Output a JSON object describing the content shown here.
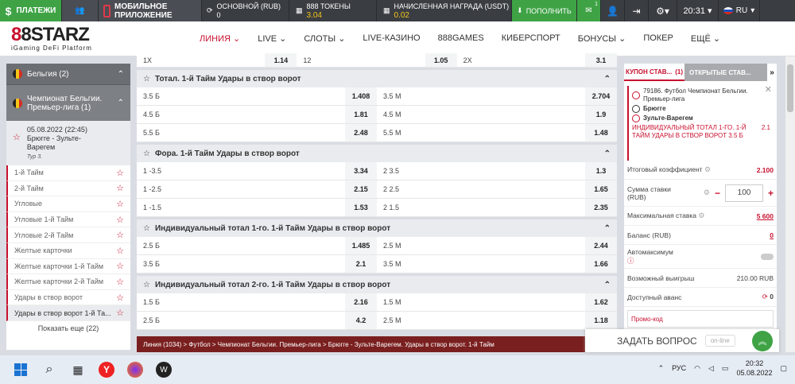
{
  "topbar": {
    "payments": "ПЛАТЕЖИ",
    "mobile": "МОБИЛЬНОЕ ПРИЛОЖЕНИЕ",
    "balance_label": "ОСНОВНОЙ (RUB)",
    "balance_value": "0",
    "tokens_label": "888 ТОКЕНЫ",
    "tokens_value": "3.04",
    "reward_label": "НАЧИСЛЕННАЯ НАГРАДА (USDT)",
    "reward_value": "0.02",
    "deposit": "ПОПОЛНИТЬ",
    "msg_count": "1",
    "time": "20:31",
    "lang": "RU"
  },
  "logo": {
    "brand_a": "8",
    "brand_b": "8STARZ",
    "sub": "iGaming DeFi Platform"
  },
  "nav": [
    "ЛИНИЯ",
    "LIVE",
    "СЛОТЫ",
    "LIVE-КАЗИНО",
    "888GAMES",
    "КИБЕРСПОРТ",
    "БОНУСЫ",
    "ПОКЕР",
    "ЕЩЁ"
  ],
  "left": {
    "country": "Бельгия (2)",
    "league": "Чемпионат Бельгии. Премьер-лига (1)",
    "match_date": "05.08.2022 (22:45)",
    "match_name": "Брюгге - Зульте-Варегем",
    "match_round": "Тур 3.",
    "items": [
      "1-й Тайм",
      "2-й Тайм",
      "Угловые",
      "Угловые 1-й Тайм",
      "Угловые 2-й Тайм",
      "Желтые карточки",
      "Желтые карточки 1-й Тайм",
      "Желтые карточки 2-й Тайм",
      "Удары в створ ворот",
      "Удары в створ ворот 1-й Та..."
    ],
    "more": "Показать еще (22)"
  },
  "top_row": [
    [
      "1X",
      "1.14"
    ],
    [
      "12",
      "1.05"
    ],
    [
      "2X",
      "3.1"
    ]
  ],
  "groups": [
    {
      "title": "Тотал. 1-й Тайм Удары в створ ворот",
      "rows": [
        [
          [
            "3.5 Б",
            "1.408"
          ],
          [
            "3.5 М",
            "2.704"
          ]
        ],
        [
          [
            "4.5 Б",
            "1.81"
          ],
          [
            "4.5 М",
            "1.9"
          ]
        ],
        [
          [
            "5.5 Б",
            "2.48"
          ],
          [
            "5.5 М",
            "1.48"
          ]
        ]
      ]
    },
    {
      "title": "Фора. 1-й Тайм Удары в створ ворот",
      "rows": [
        [
          [
            "1 -3.5",
            "3.34"
          ],
          [
            "2 3.5",
            "1.3"
          ]
        ],
        [
          [
            "1 -2.5",
            "2.15"
          ],
          [
            "2 2.5",
            "1.65"
          ]
        ],
        [
          [
            "1 -1.5",
            "1.53"
          ],
          [
            "2 1.5",
            "2.35"
          ]
        ]
      ]
    },
    {
      "title": "Индивидуальный тотал 1-го. 1-й Тайм Удары в створ ворот",
      "rows": [
        [
          [
            "2.5 Б",
            "1.485"
          ],
          [
            "2.5 М",
            "2.44"
          ]
        ],
        [
          [
            "3.5 Б",
            "2.1"
          ],
          [
            "3.5 М",
            "1.66"
          ]
        ]
      ]
    },
    {
      "title": "Индивидуальный тотал 2-го. 1-й Тайм Удары в створ ворот",
      "rows": [
        [
          [
            "1.5 Б",
            "2.16"
          ],
          [
            "1.5 М",
            "1.62"
          ]
        ],
        [
          [
            "2.5 Б",
            "4.2"
          ],
          [
            "2.5 М",
            "1.18"
          ]
        ]
      ]
    }
  ],
  "breadcrumb": "Линия (1034) > Футбол > Чемпионат Бельгии. Премьер-лига > Брюгге - Зульте-Варегем. Удары в створ ворот. 1-й Тайм",
  "ask": {
    "label": "ЗАДАТЬ ВОПРОС",
    "status": "on-line"
  },
  "coupon": {
    "tab1": "КУПОН СТАВ...",
    "tab1_count": "(1)",
    "tab2": "ОТКРЫТЫЕ СТАВ...",
    "event": "79186. Футбол Чемпионат Бельгии. Премьер-лига",
    "team1": "Брюгге",
    "team2": "Зульте-Варегем",
    "pick": "ИНДИВИДУАЛЬНЫЙ ТОТАЛ 1-ГО. 1-Й ТАЙМ УДАРЫ В СТВОР ВОРОТ 3.5 Б",
    "pick_odd": "2.1",
    "total_label": "Итоговый коэффициент",
    "total_value": "2.100",
    "stake_label": "Сумма ставки (RUB)",
    "stake_value": "100",
    "max_label": "Максимальная ставка",
    "max_value": "5 600",
    "balance_label": "Баланс (RUB)",
    "balance_value": "0",
    "automax_label": "Автомаксимум",
    "win_label": "Возможный выигрыш",
    "win_value": "210.00 RUB",
    "advance_label": "Доступный аванс",
    "advance_value": "0",
    "promo": "Промо-код"
  },
  "taskbar": {
    "lang": "РУС",
    "time": "20:32",
    "date": "05.08.2022"
  }
}
